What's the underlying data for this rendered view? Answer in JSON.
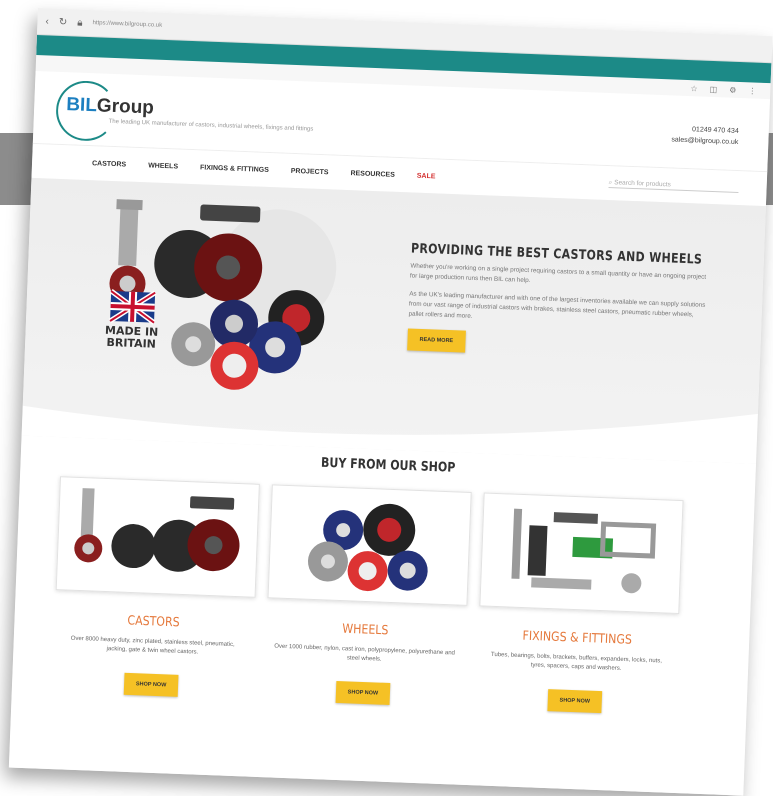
{
  "browser": {
    "url": "https://www.bilgroup.co.uk"
  },
  "brand": {
    "logo_bil": "BIL",
    "logo_group": "Group",
    "tagline": "The leading UK manufacturer of castors, industrial wheels, fixings and fittings"
  },
  "contact": {
    "phone": "01249 470 434",
    "email": "sales@bilgroup.co.uk"
  },
  "nav": {
    "castors": "CASTORS",
    "wheels": "WHEELS",
    "fixings": "FIXINGS & FITTINGS",
    "projects": "PROJECTS",
    "resources": "RESOURCES",
    "sale": "SALE",
    "search_placeholder": "Search for products"
  },
  "hero": {
    "title": "PROVIDING THE BEST CASTORS AND WHEELS",
    "para1": "Whether you're working on a single project requiring castors to a small quantity or have an ongoing project for large production runs then BIL can help.",
    "para2": "As the UK's leading manufacturer and with one of the largest inventories available we can supply solutions from our vast range of industrial castors with brakes, stainless steel castors, pneumatic rubber wheels, pallet rollers and more.",
    "button": "READ MORE",
    "badge_line1": "MADE IN",
    "badge_line2": "BRITAIN"
  },
  "shop": {
    "title": "BUY FROM OUR SHOP",
    "cards": [
      {
        "title": "CASTORS",
        "desc": "Over 8000 heavy duty, zinc plated, stainless steel, pneumatic, jacking, gate & twin wheel castors.",
        "button": "SHOP NOW"
      },
      {
        "title": "WHEELS",
        "desc": "Over 1000 rubber, nylon, cast iron, polypropylene, polyurethane and steel wheels.",
        "button": "SHOP NOW"
      },
      {
        "title": "FIXINGS & FITTINGS",
        "desc": "Tubes, bearings, bolts, brackets, buffers, expanders, locks, nuts, tyres, spacers, caps and washers.",
        "button": "SHOP NOW"
      }
    ]
  },
  "colors": {
    "teal": "#1c8a87",
    "accent_yellow": "#f5c125",
    "card_title_orange": "#e5793c",
    "sale_red": "#d32f2f"
  }
}
